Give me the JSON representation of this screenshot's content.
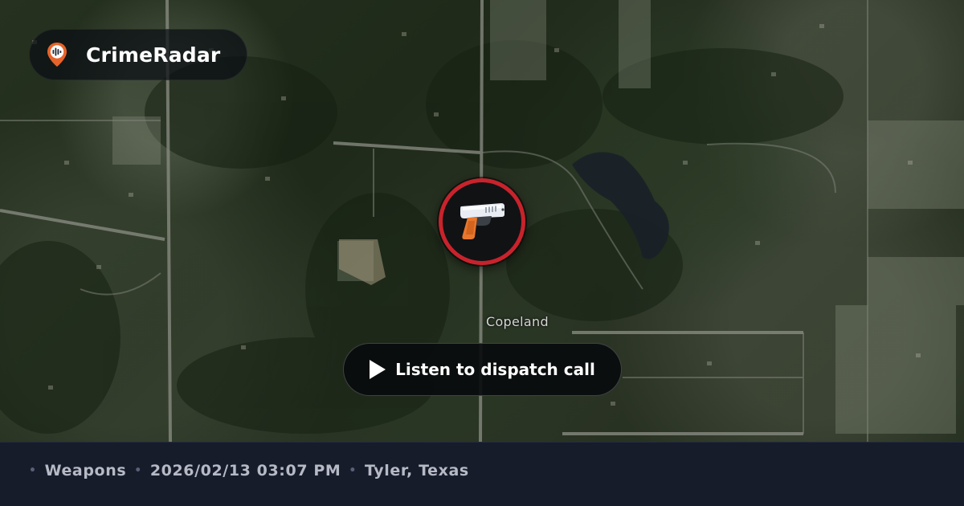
{
  "brand": {
    "name": "CrimeRadar",
    "icon": "location-pin-radar-icon",
    "pin_color": "#e8632a"
  },
  "map": {
    "place_label": "Copeland"
  },
  "incident": {
    "icon": "handgun-icon",
    "ring_color": "#c8232c"
  },
  "dispatch": {
    "play_icon": "play-icon",
    "label": "Listen to dispatch call"
  },
  "footer": {
    "separator": "•",
    "category": "Weapons",
    "datetime": "2026/02/13 03:07 PM",
    "location": "Tyler, Texas"
  }
}
